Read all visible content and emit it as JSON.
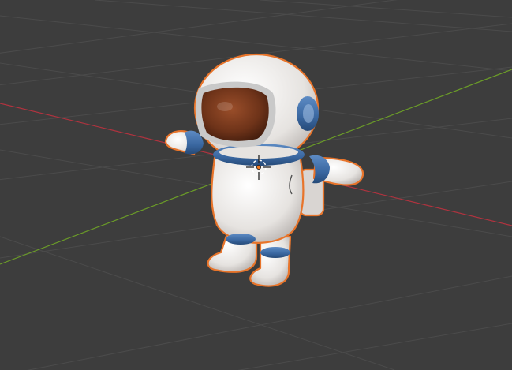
{
  "viewport": {
    "background_color": "#3d3d3d",
    "grid_line_color": "#4b4b4b",
    "x_axis_color": "#b0333f",
    "y_axis_color": "#6b9c28",
    "selection_outline_color": "#e8742a"
  },
  "scene": {
    "selected_object": "astronaut-model",
    "model_colors": {
      "suit": "#ece9e6",
      "trim": "#3c6ca4",
      "visor": "#7a3a1e",
      "visor_rim": "#c9c9c9"
    }
  },
  "gizmo": {
    "icon": "3d-cursor-icon",
    "origin_color": "#f07820"
  }
}
